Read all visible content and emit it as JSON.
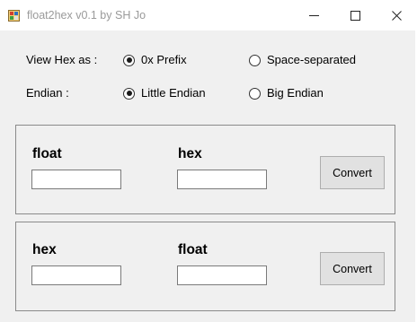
{
  "window": {
    "title": "float2hex v0.1 by SH Jo",
    "app_icon": "app-icon",
    "controls": {
      "minimize": "minimize-icon",
      "maximize": "maximize-icon",
      "close": "close-icon"
    }
  },
  "options": {
    "view_hex_label": "View Hex as :",
    "view_hex_options": [
      {
        "label": "0x Prefix",
        "checked": true
      },
      {
        "label": "Space-separated",
        "checked": false
      }
    ],
    "endian_label": "Endian :",
    "endian_options": [
      {
        "label": "Little Endian",
        "checked": true
      },
      {
        "label": "Big Endian",
        "checked": false
      }
    ]
  },
  "float_to_hex": {
    "input_label": "float",
    "input_value": "",
    "output_label": "hex",
    "output_value": "",
    "button_label": "Convert"
  },
  "hex_to_float": {
    "input_label": "hex",
    "input_value": "",
    "output_label": "float",
    "output_value": "",
    "button_label": "Convert"
  },
  "colors": {
    "client_background": "#f0f0f0",
    "title_text": "#9a9a9a",
    "group_border": "#8a8a8a",
    "button_background": "#e1e1e1"
  }
}
